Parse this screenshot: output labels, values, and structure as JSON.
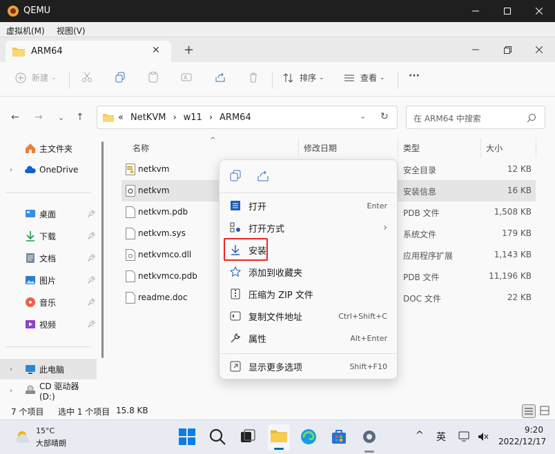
{
  "qemu": {
    "title": "QEMU",
    "menu": [
      "虚拟机(M)",
      "视图(V)"
    ]
  },
  "explorer": {
    "tab_title": "ARM64",
    "toolbar": {
      "new_label": "新建",
      "sort_label": "排序",
      "view_label": "查看",
      "more_label": "···"
    },
    "breadcrumb": [
      "«",
      "NetKVM",
      "›",
      "w11",
      "›",
      "ARM64"
    ],
    "search_placeholder": "在 ARM64 中搜索",
    "nav": {
      "home": "主文件夹",
      "onedrive": "OneDrive",
      "desktop": "桌面",
      "downloads": "下载",
      "documents": "文档",
      "pictures": "图片",
      "music": "音乐",
      "videos": "视频",
      "thispc": "此电脑",
      "cdrive": "CD 驱动器 (D:)"
    },
    "columns": {
      "name": "名称",
      "date": "修改日期",
      "type": "类型",
      "size": "大小"
    },
    "files": [
      {
        "name": "netkvm",
        "type": "安全目录",
        "size": "12 KB"
      },
      {
        "name": "netkvm",
        "type": "安装信息",
        "size": "16 KB"
      },
      {
        "name": "netkvm.pdb",
        "type": "PDB 文件",
        "size": "1,508 KB"
      },
      {
        "name": "netkvm.sys",
        "type": "系统文件",
        "size": "179 KB"
      },
      {
        "name": "netkvmco.dll",
        "type": "应用程序扩展",
        "size": "1,143 KB"
      },
      {
        "name": "netkvmco.pdb",
        "type": "PDB 文件",
        "size": "11,196 KB"
      },
      {
        "name": "readme.doc",
        "type": "DOC 文件",
        "size": "22 KB"
      }
    ],
    "status": {
      "count": "7 个项目",
      "selected": "选中 1 个项目",
      "size": "15.8 KB"
    }
  },
  "context_menu": {
    "items": [
      {
        "label": "打开",
        "key": "Enter"
      },
      {
        "label": "打开方式",
        "key": "›"
      },
      {
        "label": "安装",
        "key": ""
      },
      {
        "label": "添加到收藏夹",
        "key": ""
      },
      {
        "label": "压缩为 ZIP 文件",
        "key": ""
      },
      {
        "label": "复制文件地址",
        "key": "Ctrl+Shift+C"
      },
      {
        "label": "属性",
        "key": "Alt+Enter"
      },
      {
        "label": "显示更多选项",
        "key": "Shift+F10"
      }
    ]
  },
  "taskbar": {
    "temp": "15°C",
    "weather": "大部晴朗",
    "ime": "英",
    "time": "9:20",
    "date": "2022/12/17"
  },
  "colors": {
    "accent": "#0067c0",
    "highlight": "#e22222"
  }
}
